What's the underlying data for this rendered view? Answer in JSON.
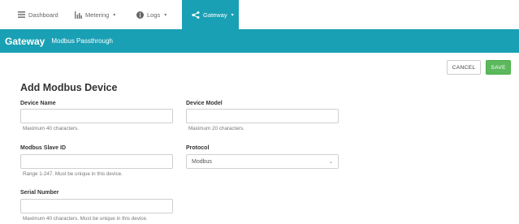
{
  "nav": {
    "items": [
      {
        "label": "Dashboard",
        "icon": "list-icon"
      },
      {
        "label": "Metering",
        "icon": "bar-chart-icon",
        "caret": "▾"
      },
      {
        "label": "Logs",
        "icon": "info-icon",
        "caret": "▾"
      },
      {
        "label": "Gateway",
        "icon": "share-icon",
        "caret": "▾",
        "active": true
      }
    ]
  },
  "header": {
    "title": "Gateway",
    "subtitle": "Modbus Passthrough"
  },
  "actions": {
    "cancel": "CANCEL",
    "save": "SAVE"
  },
  "form": {
    "title": "Add Modbus Device",
    "device_name": {
      "label": "Device Name",
      "value": "",
      "help": "Maximum 40 characters."
    },
    "device_model": {
      "label": "Device Model",
      "value": "",
      "help": "Maximum 20 characters."
    },
    "slave_id": {
      "label": "Modbus Slave ID",
      "value": "",
      "help": "Range 1-247. Must be unique in this device."
    },
    "protocol": {
      "label": "Protocol",
      "value": "Modbus"
    },
    "serial_number": {
      "label": "Serial Number",
      "value": "",
      "help": "Maximum 40 characters. Must be unique in this device."
    }
  },
  "colors": {
    "accent": "#1aa0b4",
    "save": "#5cb85c"
  }
}
